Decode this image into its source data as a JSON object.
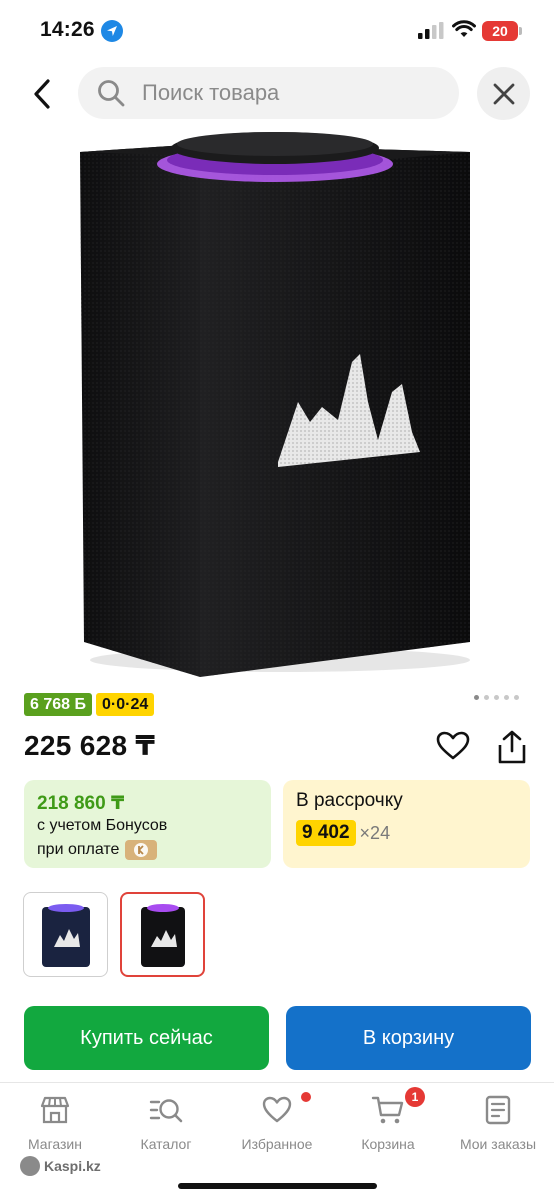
{
  "status_bar": {
    "time": "14:26",
    "battery": "20"
  },
  "search": {
    "placeholder": "Поиск товара"
  },
  "gallery": {
    "pages": 5,
    "active_page": 1
  },
  "badges": {
    "bonus": "6 768 Б",
    "installment": "0·0·24"
  },
  "product": {
    "price": "225 628 ₸"
  },
  "bonus_card": {
    "amount": "218 860 ₸",
    "line1": "с учетом Бонусов",
    "line2": "при оплате"
  },
  "installment_card": {
    "title": "В рассрочку",
    "monthly": "9 402",
    "months": "×24"
  },
  "variants": [
    {
      "name": "blue"
    },
    {
      "name": "black",
      "selected": true
    }
  ],
  "actions": {
    "buy_now": "Купить сейчас",
    "add_to_cart": "В корзину"
  },
  "tabbar": {
    "tabs": [
      {
        "label": "Магазин",
        "icon": "shop-icon"
      },
      {
        "label": "Каталог",
        "icon": "catalog-search-icon"
      },
      {
        "label": "Избранное",
        "icon": "heart-icon",
        "dot": true
      },
      {
        "label": "Корзина",
        "icon": "cart-icon",
        "badge": "1"
      },
      {
        "label": "Мои заказы",
        "icon": "orders-icon"
      }
    ],
    "brand": "Kaspi.kz"
  },
  "colors": {
    "green": "#12a83f",
    "blue": "#1471c9",
    "yellow": "#ffd400",
    "red": "#e53935"
  }
}
